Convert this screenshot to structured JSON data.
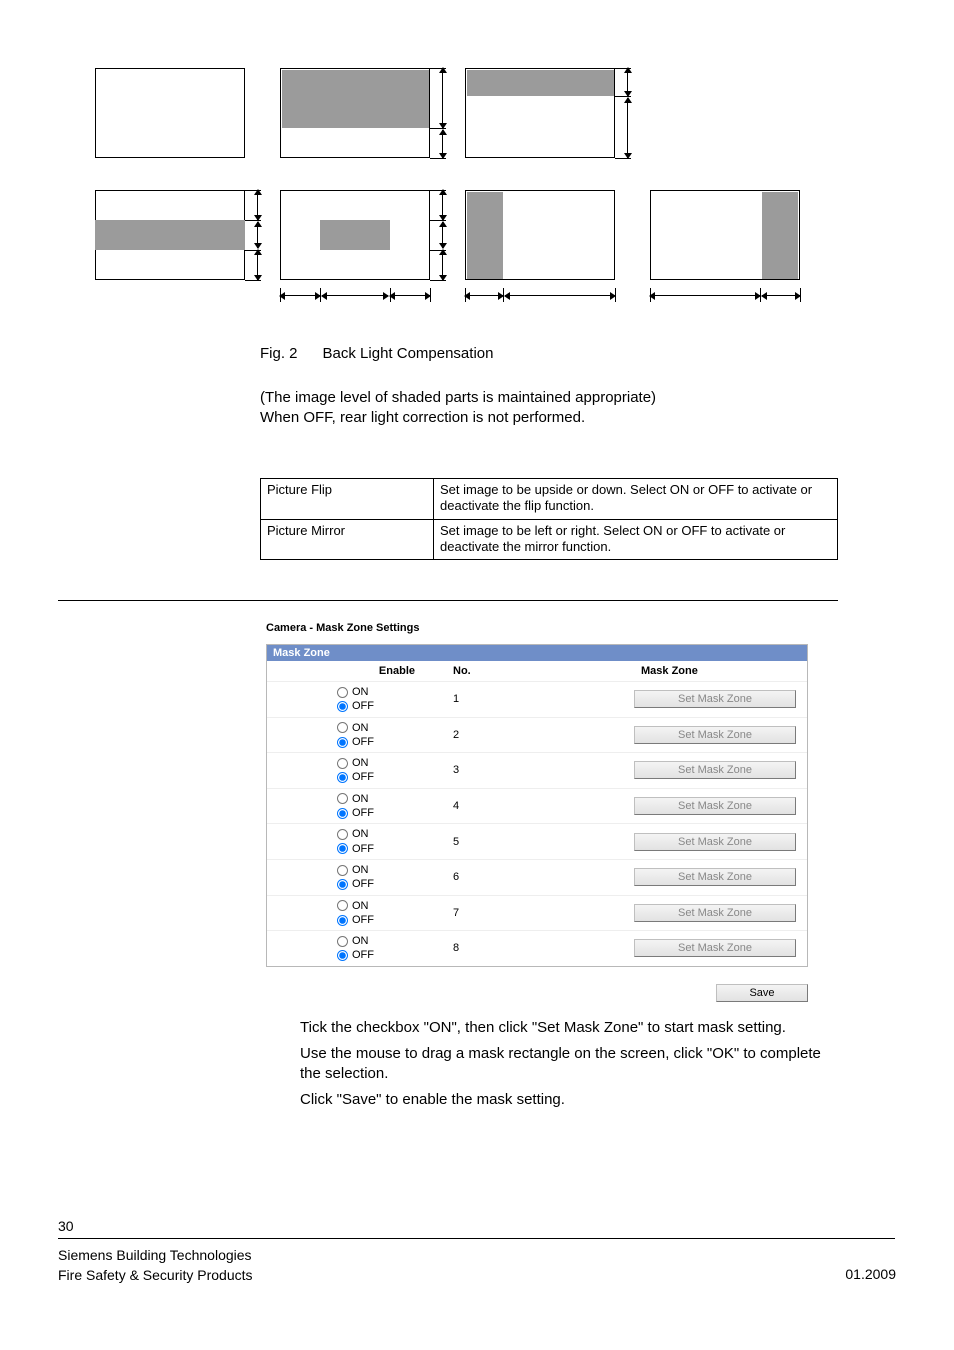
{
  "figure": {
    "label": "Fig. 2",
    "title": "Back Light Compensation",
    "note1": "(The image level of shaded parts is maintained appropriate)",
    "note2": "When OFF, rear light correction is not performed."
  },
  "table1": {
    "rows": [
      {
        "name": "Picture Flip",
        "desc": "Set image to be upside or down. Select ON or OFF to activate or deactivate the flip function."
      },
      {
        "name": "Picture Mirror",
        "desc": "Set image to be left or right. Select ON or OFF to activate or deactivate the mirror function."
      }
    ]
  },
  "camera": {
    "screen_title": "Camera - Mask Zone Settings",
    "panel_title": "Mask Zone",
    "columns": {
      "enable": "Enable",
      "no": "No.",
      "maskzone": "Mask Zone"
    },
    "on_label": "ON",
    "off_label": "OFF",
    "button_label": "Set Mask Zone",
    "rows": [
      1,
      2,
      3,
      4,
      5,
      6,
      7,
      8
    ],
    "save_label": "Save"
  },
  "instructions": {
    "l1": "Tick the checkbox \"ON\", then click \"Set Mask Zone\" to start mask setting.",
    "l2": "Use the mouse to drag a mask rectangle on the screen, click \"OK\" to complete the selection.",
    "l3": "Click \"Save\" to enable the mask setting."
  },
  "footer": {
    "page": "30",
    "line1": "Siemens Building Technologies",
    "line2": "Fire Safety & Security Products",
    "date": "01.2009"
  }
}
